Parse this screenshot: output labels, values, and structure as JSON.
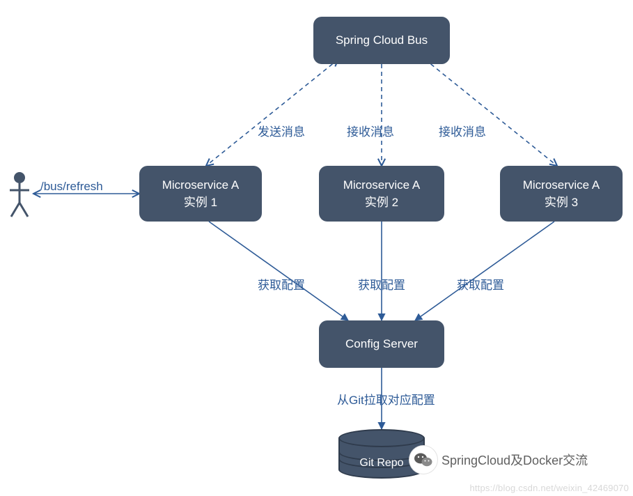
{
  "colors": {
    "node_fill": "#44546a",
    "node_text": "#ffffff",
    "edge_solid": "#2e5b97",
    "edge_dashed": "#2e5b97",
    "label": "#2e5b97"
  },
  "nodes": {
    "bus": {
      "title": "Spring Cloud Bus"
    },
    "svc1": {
      "title": "Microservice A",
      "subtitle": "实例 1"
    },
    "svc2": {
      "title": "Microservice  A",
      "subtitle": "实例 2"
    },
    "svc3": {
      "title": "Microservice A",
      "subtitle": "实例 3"
    },
    "config": {
      "title": "Config Server"
    },
    "git": {
      "title": "Git Repo"
    }
  },
  "edges": {
    "actor_svc1": {
      "label": "/bus/refresh"
    },
    "bus_svc1": {
      "label": "发送消息",
      "style": "dashed"
    },
    "bus_svc2": {
      "label": "接收消息",
      "style": "dashed"
    },
    "bus_svc3": {
      "label": "接收消息",
      "style": "dashed"
    },
    "svc1_config": {
      "label": "获取配置",
      "style": "solid"
    },
    "svc2_config": {
      "label": "获取配置",
      "style": "solid"
    },
    "svc3_config": {
      "label": "获取配置",
      "style": "solid"
    },
    "config_git": {
      "label": "从Git拉取对应配置",
      "style": "solid"
    }
  },
  "watermark": {
    "wechat_label": "SpringCloud及Docker交流",
    "footer": "https://blog.csdn.net/weixin_42469070"
  }
}
